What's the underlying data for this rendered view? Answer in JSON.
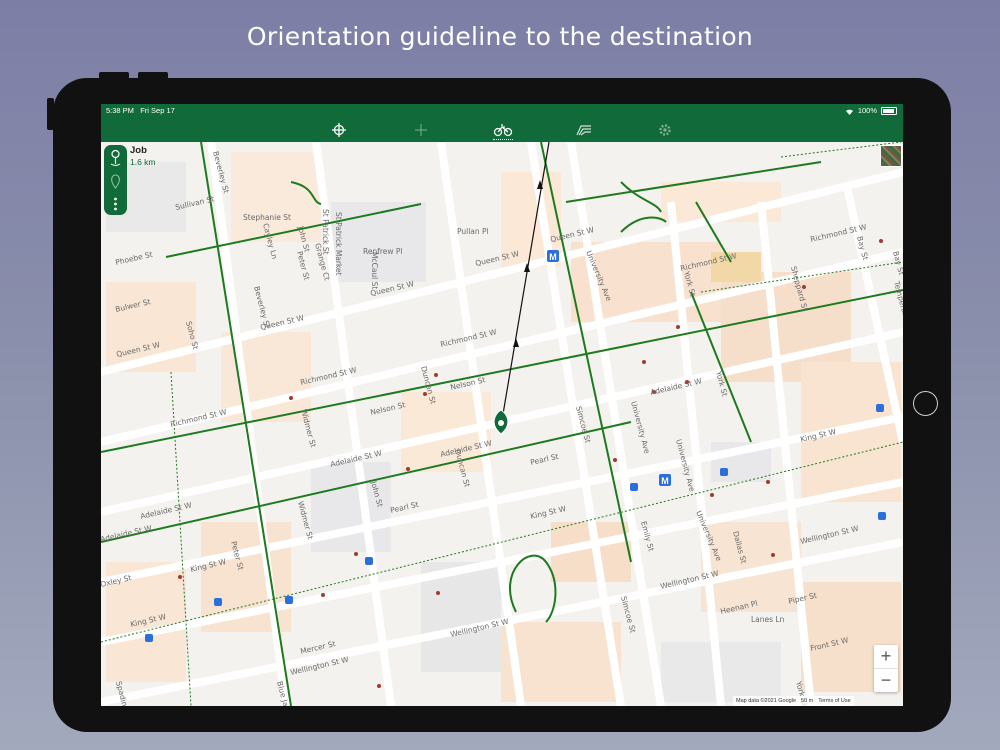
{
  "headline": "Orientation guideline to the destination",
  "status_bar": {
    "time": "5:38 PM",
    "date": "Fri Sep 17",
    "battery": "100%"
  },
  "toolbar": {
    "items": [
      {
        "icon": "crosshair-icon"
      },
      {
        "icon": "crosshair-faded-icon"
      },
      {
        "icon": "bicycle-icon",
        "active": true
      },
      {
        "icon": "layers-icon"
      },
      {
        "icon": "gear-icon"
      }
    ]
  },
  "destination": {
    "title": "Job",
    "distance": "1.6 km"
  },
  "zoom": {
    "plus": "+",
    "minus": "−"
  },
  "attribution": {
    "map_data": "Map data ©2021 Google",
    "scale": "50 m",
    "terms": "Terms of Use"
  },
  "colors": {
    "primary": "#106a3a",
    "bike_lane": "#1e7a1e",
    "route_line": "#111111",
    "poi": "#a33a2e",
    "transit": "#2a6fdb"
  },
  "map": {
    "streets": [
      "Queen St W",
      "Queen St W",
      "Queen St W",
      "Queen St W",
      "Queen St W",
      "Richmond St W",
      "Richmond St W",
      "Richmond St W",
      "Richmond St W",
      "Richmond St W",
      "Adelaide St W",
      "Adelaide St W",
      "Adelaide St W",
      "Adelaide St W",
      "Adelaide St W",
      "King St W",
      "King St W",
      "King St W",
      "King St W",
      "Wellington St W",
      "Wellington St W",
      "Wellington St W",
      "Wellington St W",
      "Front St W",
      "Pearl St",
      "Pearl St",
      "Nelson St",
      "Nelson St",
      "Sullivan St",
      "Phoebe St",
      "Bulwer St",
      "Oxley St",
      "Mercer St",
      "Piper St",
      "Heenan Pl",
      "Beverley St",
      "Beverley St",
      "Peter St",
      "Peter St",
      "Blue Jays Way",
      "John St",
      "John St",
      "Duncan St",
      "Duncan St",
      "Widmer St",
      "Widmer St",
      "Simcoe St",
      "Simcoe St",
      "University Ave",
      "University Ave",
      "University Ave",
      "University Ave",
      "Emily St",
      "York St",
      "York St",
      "York St",
      "Bay St",
      "Bay St",
      "Temperance St",
      "Sheppard St",
      "Pullan Pl",
      "St Patrick St",
      "St Patrick Market",
      "Renfrew Pl",
      "McCaul St",
      "Stephanie St",
      "Cayley Ln",
      "Grange Ct",
      "Soho St",
      "Spadina Ave",
      "Dallas St",
      "Lanes Ln"
    ]
  }
}
